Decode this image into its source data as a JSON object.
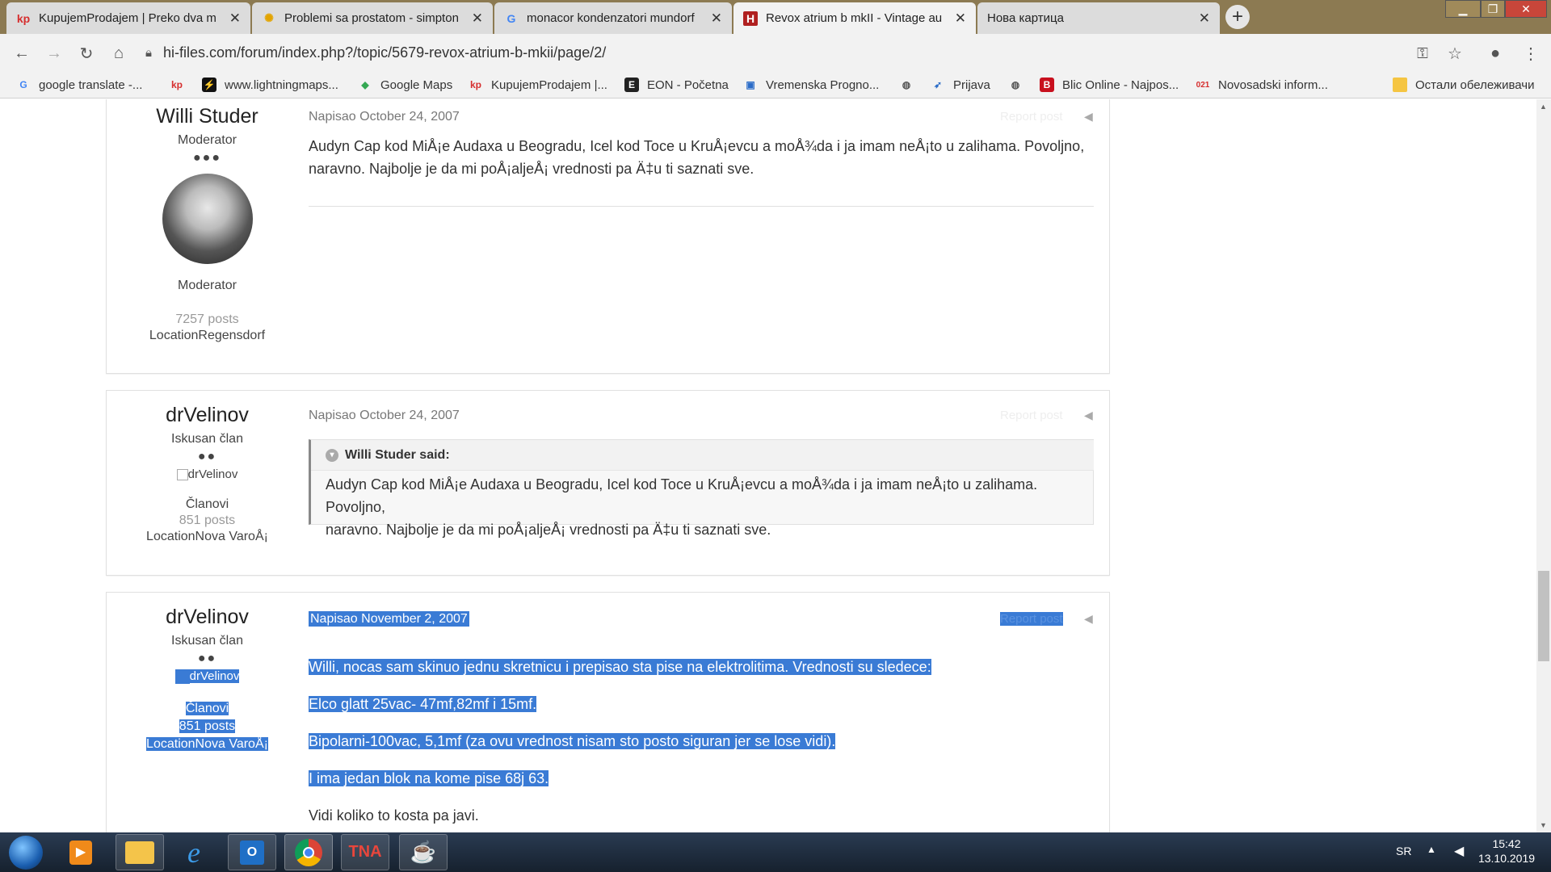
{
  "tabs": [
    {
      "label": "KupujemProdajem | Preko dva m",
      "favicon": "kp"
    },
    {
      "label": "Problemi sa prostatom - simpton",
      "favicon": "✺"
    },
    {
      "label": "monacor kondenzatori mundorf",
      "favicon": "G"
    },
    {
      "label": "Revox atrium b mkII - Vintage au",
      "favicon": "H"
    },
    {
      "label": "Нова картица",
      "favicon": ""
    }
  ],
  "url": "hi-files.com/forum/index.php?/topic/5679-revox-atrium-b-mkii/page/2/",
  "bookmarks": [
    {
      "label": "google translate -...",
      "icon": "G"
    },
    {
      "label": "",
      "icon": "kp"
    },
    {
      "label": "www.lightningmaps...",
      "icon": "⚡"
    },
    {
      "label": "Google Maps",
      "icon": "◆"
    },
    {
      "label": "KupujemProdajem |...",
      "icon": "kp"
    },
    {
      "label": "EON - Početna",
      "icon": "E"
    },
    {
      "label": "Vremenska Progno...",
      "icon": "▣"
    },
    {
      "label": "",
      "icon": "◍"
    },
    {
      "label": "Prijava",
      "icon": "➶"
    },
    {
      "label": "",
      "icon": "◍"
    },
    {
      "label": "Blic Online - Najpos...",
      "icon": "B"
    },
    {
      "label": "Novosadski inform...",
      "icon": "021"
    }
  ],
  "other_bookmarks": "Остали обележивачи",
  "posts": [
    {
      "author": "Willi Studer",
      "rank": "Moderator",
      "rank_dots": "●●●",
      "group": "Moderator",
      "posts": "7257 posts",
      "location": "LocationRegensdorf",
      "meta": "Napisao October 24, 2007",
      "report": "Report post",
      "text": [
        "Audyn Cap kod MiÅ¡e Audaxa u Beogradu, Icel kod Toce u KruÅ¡evcu a moÅ¾da i ja imam neÅ¡to u zalihama. Povoljno,",
        "naravno. Najbolje je da mi poÅ¡aljeÅ¡ vrednosti pa Ä‡u ti saznati sve."
      ]
    },
    {
      "author": "drVelinov",
      "rank": "Iskusan član",
      "rank_dots": "●●",
      "avatar_alt": "drVelinov",
      "group": "Članovi",
      "posts": "851 posts",
      "location": "LocationNova VaroÅ¡",
      "meta": "Napisao October 24, 2007",
      "report": "Report post",
      "quote_author": "Willi Studer said:",
      "quote_text": [
        "Audyn Cap kod MiÅ¡e Audaxa u Beogradu, Icel kod Toce u KruÅ¡evcu a moÅ¾da i ja imam neÅ¡to u zalihama. Povoljno,",
        "naravno. Najbolje je da mi poÅ¡aljeÅ¡ vrednosti pa Ä‡u ti saznati sve."
      ]
    },
    {
      "author": "drVelinov",
      "rank": "Iskusan član",
      "rank_dots": "●●",
      "avatar_alt": "drVelinov",
      "group": "Članovi",
      "posts": "851 posts",
      "location": "LocationNova VaroÅ¡",
      "meta": "Napisao November 2, 2007",
      "report": "Report post",
      "paragraphs": [
        "Willi, nocas sam skinuo jednu skretnicu i prepisao sta pise na elektrolitima. Vrednosti su sledece:",
        "Elco glatt 25vac- 47mf,82mf i 15mf.",
        "Bipolarni-100vac, 5,1mf (za ovu vrednost nisam sto posto siguran jer se lose vidi).",
        "I ima jedan blok na kome pise 68j 63.",
        "Vidi koliko to kosta pa javi."
      ]
    }
  ],
  "taskbar": {
    "lang": "SR",
    "time": "15:42",
    "date": "13.10.2019",
    "apps": [
      "start-orb",
      "media-player",
      "file-explorer",
      "internet-explorer",
      "outlook",
      "chrome",
      "tna",
      "java"
    ]
  },
  "colors": {
    "selection": "#3a7bd5",
    "tab_active": "#f2f2f2",
    "tab_inactive": "#dcdcdc"
  }
}
